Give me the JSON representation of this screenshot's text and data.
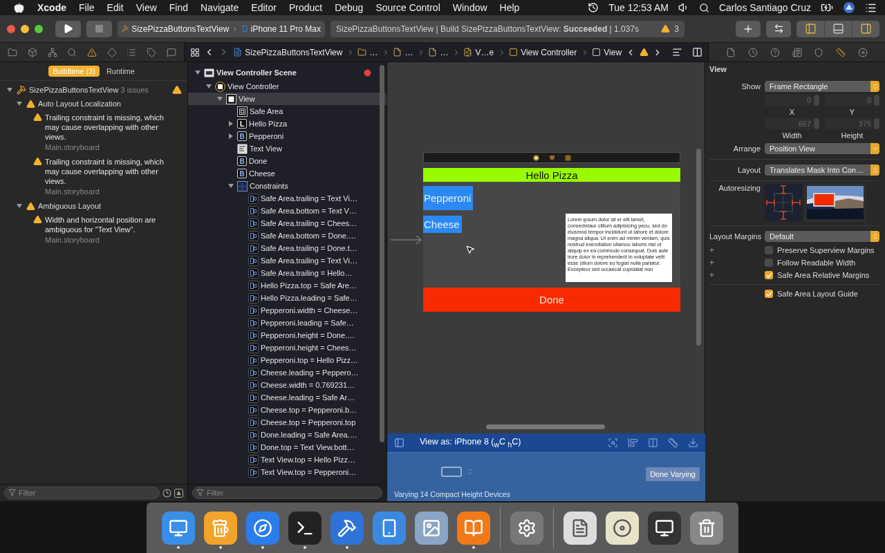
{
  "menu_bar": {
    "app": "Xcode",
    "menus": [
      "File",
      "Edit",
      "View",
      "Find",
      "Navigate",
      "Editor",
      "Product",
      "Debug",
      "Source Control",
      "Window",
      "Help"
    ],
    "time": "Tue 12:53 AM",
    "user": "Carlos Santiago Cruz"
  },
  "toolbar": {
    "scheme": "SizePizzaButtonsTextView",
    "device": "iPhone 11 Pro Max",
    "activity": "SizePizzaButtonsTextView | Build SizePizzaButtonsTextView: **Succeeded** | 1.037s",
    "warning_count": "3",
    "panes": [
      {
        "kind": "navigator",
        "on": true
      },
      {
        "kind": "debug",
        "on": false
      },
      {
        "kind": "inspector",
        "on": true
      }
    ]
  },
  "navigator_tabs": [
    {
      "kind": "folder",
      "selected": false
    },
    {
      "kind": "source",
      "selected": false
    },
    {
      "kind": "symbols",
      "selected": false
    },
    {
      "kind": "find",
      "selected": false
    },
    {
      "kind": "issues",
      "selected": true
    },
    {
      "kind": "tests",
      "selected": false
    },
    {
      "kind": "debug",
      "selected": false
    },
    {
      "kind": "breakpoints",
      "selected": false
    },
    {
      "kind": "reports",
      "selected": false
    }
  ],
  "jump_bar": [
    {
      "kind": "project",
      "label": "SizePizzaButtonsTextView"
    },
    {
      "kind": "folder",
      "label": "…"
    },
    {
      "kind": "file",
      "label": "…"
    },
    {
      "kind": "file",
      "label": "…"
    },
    {
      "kind": "storyboard",
      "label": "V…e"
    },
    {
      "kind": "controller",
      "label": "View Controller"
    },
    {
      "kind": "view",
      "label": "View"
    }
  ],
  "inspector_tabs": [
    {
      "kind": "file",
      "selected": false
    },
    {
      "kind": "history",
      "selected": false
    },
    {
      "kind": "help",
      "selected": false
    },
    {
      "kind": "identity",
      "selected": false
    },
    {
      "kind": "attributes",
      "selected": false
    },
    {
      "kind": "size",
      "selected": true
    },
    {
      "kind": "connections",
      "selected": false
    }
  ],
  "issues": {
    "tabs": [
      {
        "label": "Buildtime (3)",
        "selected": true
      },
      {
        "label": "Runtime",
        "selected": false
      }
    ],
    "project": {
      "name": "SizePizzaButtonsTextView",
      "count": "3 issues",
      "expanded": true
    },
    "groups": [
      {
        "title": "Auto Layout Localization",
        "expanded": true,
        "issues": [
          {
            "message": "Trailing constraint is missing, which may cause overlapping with other views.",
            "file": "Main.storyboard"
          },
          {
            "message": "Trailing constraint is missing, which may cause overlapping with other views.",
            "file": "Main.storyboard"
          }
        ]
      },
      {
        "title": "Ambiguous Layout",
        "expanded": true,
        "issues": [
          {
            "message": "Width and horizontal position are ambiguous for \"Text View\".",
            "file": "Main.storyboard"
          }
        ]
      }
    ],
    "filter_placeholder": "Filter"
  },
  "outline": {
    "filter_placeholder": "Filter",
    "tree": [
      {
        "label": "View Controller Scene",
        "kind": "scene",
        "selected": false,
        "expanded": true,
        "children": [
          {
            "label": "View Controller",
            "kind": "controller",
            "selected": false,
            "expanded": true,
            "children": [
              {
                "label": "View",
                "kind": "view",
                "selected": true,
                "expanded": true,
                "children": [
                  {
                    "label": "Safe Area",
                    "kind": "safe-area",
                    "selected": false
                  },
                  {
                    "label": "Hello Pizza",
                    "kind": "label",
                    "glyph": "L",
                    "selected": false,
                    "expanded": false
                  },
                  {
                    "label": "Pepperoni",
                    "kind": "button",
                    "glyph": "B",
                    "selected": false,
                    "expanded": false
                  },
                  {
                    "label": "Text View",
                    "kind": "text-view",
                    "selected": false
                  },
                  {
                    "label": "Done",
                    "kind": "button",
                    "glyph": "B",
                    "selected": false
                  },
                  {
                    "label": "Cheese",
                    "kind": "button",
                    "glyph": "B",
                    "selected": false
                  },
                  {
                    "label": "Constraints",
                    "kind": "constraints",
                    "selected": false,
                    "expanded": true,
                    "children": [
                      {
                        "label": "Safe Area.trailing = Text Vi…",
                        "kind": "constraint",
                        "selected": false
                      },
                      {
                        "label": "Safe Area.bottom = Text V…",
                        "kind": "constraint",
                        "selected": false
                      },
                      {
                        "label": "Safe Area.trailing = Chees…",
                        "kind": "constraint",
                        "selected": false
                      },
                      {
                        "label": "Safe Area.bottom = Done.…",
                        "kind": "constraint",
                        "selected": false
                      },
                      {
                        "label": "Safe Area.trailing = Done.t…",
                        "kind": "constraint",
                        "selected": false
                      },
                      {
                        "label": "Safe Area.trailing = Text Vi…",
                        "kind": "constraint",
                        "selected": false
                      },
                      {
                        "label": "Safe Area.trailing = Hello…",
                        "kind": "constraint",
                        "selected": false
                      },
                      {
                        "label": "Hello Pizza.top = Safe Are…",
                        "kind": "constraint",
                        "selected": false
                      },
                      {
                        "label": "Hello Pizza.leading = Safe…",
                        "kind": "constraint",
                        "selected": false
                      },
                      {
                        "label": "Pepperoni.width = Cheese…",
                        "kind": "constraint",
                        "selected": false
                      },
                      {
                        "label": "Pepperoni.leading = Safe…",
                        "kind": "constraint",
                        "selected": false
                      },
                      {
                        "label": "Pepperoni.height = Done.…",
                        "kind": "constraint",
                        "selected": false
                      },
                      {
                        "label": "Pepperoni.height = Chees…",
                        "kind": "constraint",
                        "selected": false
                      },
                      {
                        "label": "Pepperoni.top = Hello Pizz…",
                        "kind": "constraint",
                        "selected": false
                      },
                      {
                        "label": "Cheese.leading = Peppero…",
                        "kind": "constraint",
                        "selected": false
                      },
                      {
                        "label": "Cheese.width = 0.769231…",
                        "kind": "constraint",
                        "selected": false
                      },
                      {
                        "label": "Cheese.leading = Safe Ar…",
                        "kind": "constraint",
                        "selected": false
                      },
                      {
                        "label": "Cheese.top = Pepperoni.b…",
                        "kind": "constraint",
                        "selected": false
                      },
                      {
                        "label": "Cheese.top = Pepperoni.top",
                        "kind": "constraint",
                        "selected": false
                      },
                      {
                        "label": "Done.leading = Safe Area.…",
                        "kind": "constraint",
                        "selected": false
                      },
                      {
                        "label": "Done.top = Text View.bott…",
                        "kind": "constraint",
                        "selected": false
                      },
                      {
                        "label": "Text View.top = Hello Pizz…",
                        "kind": "constraint",
                        "selected": false
                      },
                      {
                        "label": "Text View.top = Pepperoni…",
                        "kind": "constraint",
                        "selected": false
                      }
                    ]
                  }
                ]
              }
            ]
          }
        ]
      }
    ]
  },
  "canvas": {
    "label": "Hello Pizza",
    "buttons": [
      {
        "label": "Pepperoni"
      },
      {
        "label": "Cheese"
      }
    ],
    "text_view": "Lorem ipsum dolor sit er elit lamet, consectetaur cillium adipisicing pecu, sed do eiusmod tempor incididunt ut labore et dolore magna aliqua. Ut enim ad minim veniam, quis nostrud exercitation ullamco laboris nisi ut aliquip ex ea commodo consequat. Duis aute irure dolor in reprehenderit in voluptate velit esse cillum dolore eu fugiat nulla pariatur. Excepteur sint occaecat cupidatat non",
    "done": "Done"
  },
  "device_bar": {
    "title": "View as: iPhone 8 ($_{w}$C $_{h}$C)",
    "done_button": "Done Varying",
    "status": "Varying 14 Compact Height Devices"
  },
  "inspector": {
    "title": "View",
    "show": {
      "label": "Show",
      "value": "Frame Rectangle"
    },
    "frame": [
      {
        "label": "X",
        "value": "0",
        "disabled": true
      },
      {
        "label": "Y",
        "value": "0",
        "disabled": true
      },
      {
        "label": "Width",
        "value": "667",
        "disabled": true
      },
      {
        "label": "Height",
        "value": "375",
        "disabled": true
      }
    ],
    "arrange": {
      "label": "Arrange",
      "value": "Position View"
    },
    "layout": {
      "label": "Layout",
      "value": "Translates Mask Into Con…"
    },
    "autoresizing": {
      "label": "Autoresizing"
    },
    "layout_margins": {
      "label": "Layout Margins",
      "value": "Default"
    },
    "options": [
      {
        "label": "Preserve Superview Margins",
        "checked": false,
        "plus": "+"
      },
      {
        "label": "Follow Readable Width",
        "checked": false,
        "plus": "+"
      },
      {
        "label": "Safe Area Relative Margins",
        "checked": true,
        "plus": "+"
      }
    ],
    "guide": {
      "label": "Safe Area Layout Guide",
      "checked": true
    }
  },
  "dock": {
    "sections": [
      {
        "items": [
          {
            "kind": "finder",
            "running": true
          },
          {
            "kind": "beer",
            "running": true
          },
          {
            "kind": "safari",
            "running": true
          },
          {
            "kind": "terminal",
            "running": true
          },
          {
            "kind": "xcode",
            "running": true
          },
          {
            "kind": "simulator",
            "running": false
          },
          {
            "kind": "preview",
            "running": false
          },
          {
            "kind": "books",
            "running": true
          }
        ]
      },
      {
        "items": [
          {
            "kind": "settings",
            "running": false
          }
        ]
      },
      {
        "items": [
          {
            "kind": "pdf",
            "running": false
          },
          {
            "kind": "dvd",
            "running": false
          },
          {
            "kind": "screen",
            "running": false
          },
          {
            "kind": "trash",
            "running": false
          }
        ]
      }
    ]
  }
}
